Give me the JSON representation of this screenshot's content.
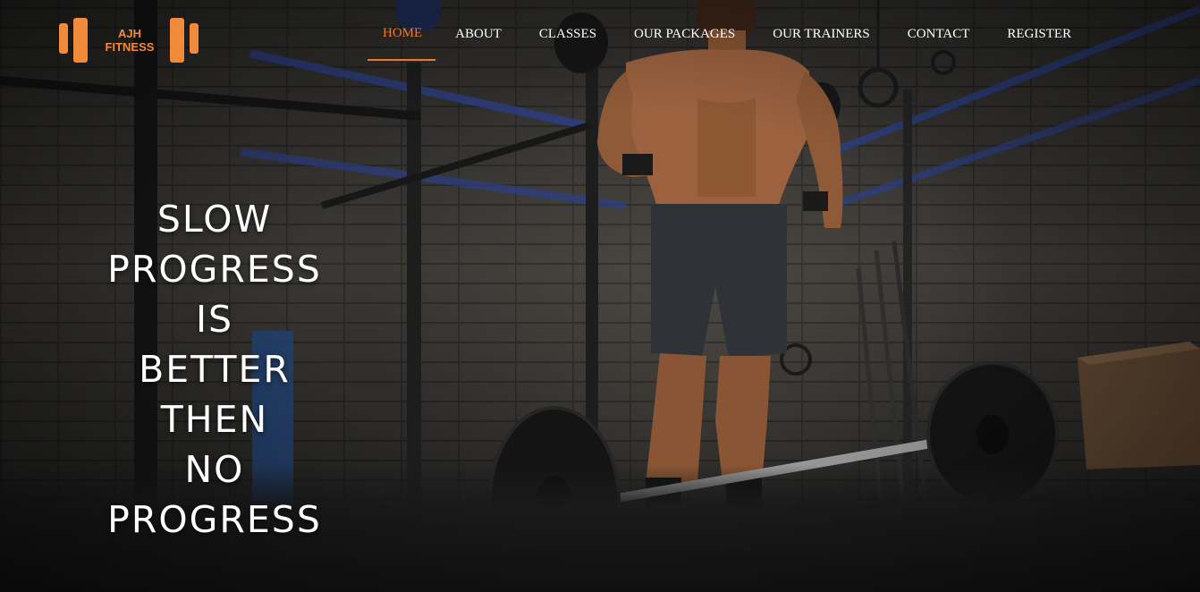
{
  "brand": {
    "name_line1": "AJH",
    "name_line2": "FITNESS",
    "accent_color": "#f28a3b",
    "icon": "dumbbell-icon"
  },
  "nav": {
    "items": [
      {
        "label": "HOME",
        "active": true
      },
      {
        "label": "ABOUT",
        "active": false
      },
      {
        "label": "CLASSES",
        "active": false
      },
      {
        "label": "OUR PACKAGES",
        "active": false
      },
      {
        "label": "OUR TRAINERS",
        "active": false
      },
      {
        "label": "CONTACT",
        "active": false
      },
      {
        "label": "REGISTER",
        "active": false
      }
    ],
    "active_color": "#f0782b"
  },
  "hero": {
    "headline_lines": [
      "SLOW",
      "PROGRESS",
      "IS",
      "BETTER",
      "THEN",
      "NO",
      "PROGRESS"
    ]
  }
}
